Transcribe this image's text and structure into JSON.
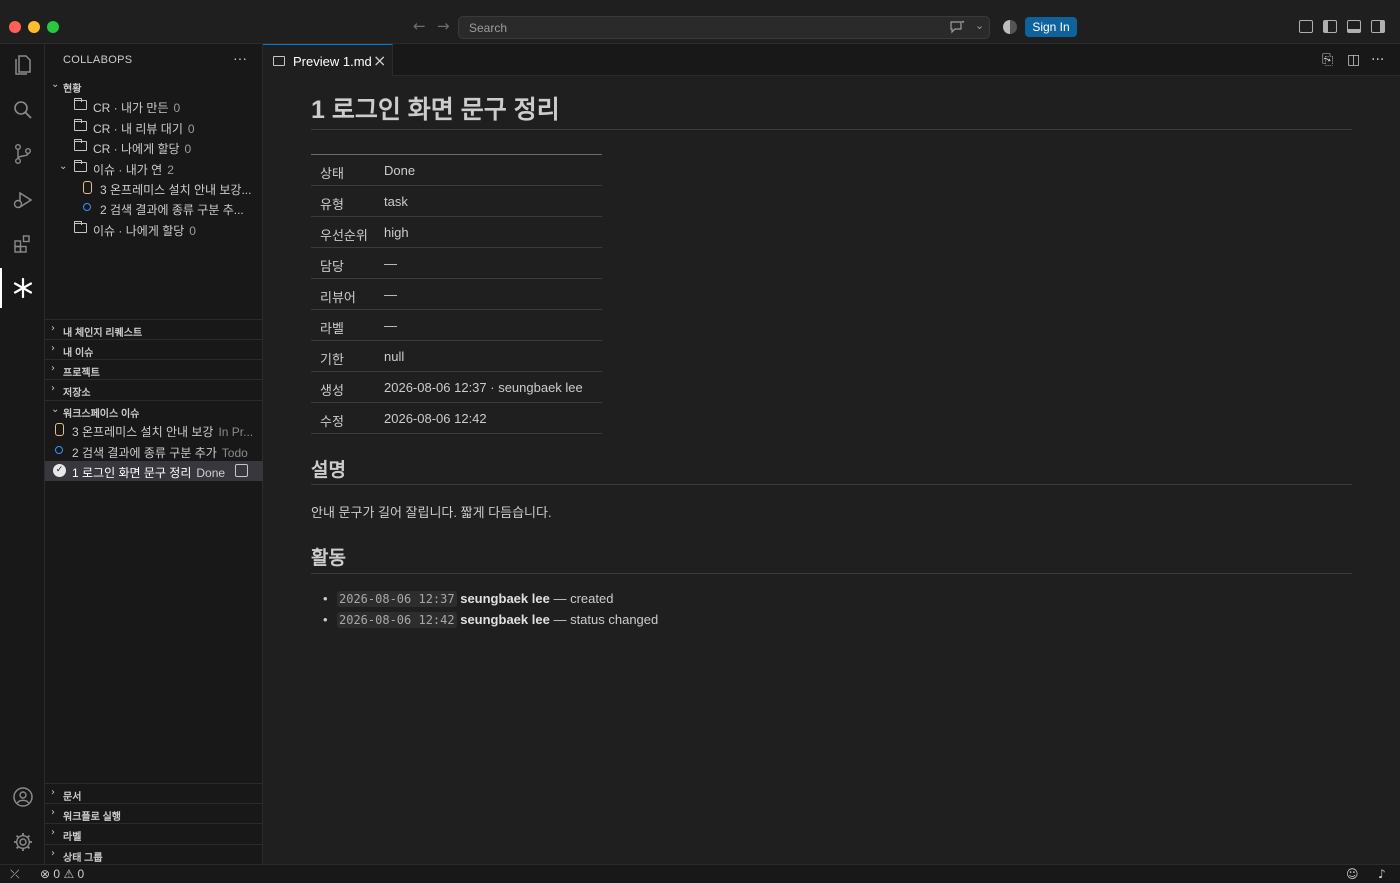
{
  "titlebar": {
    "search_placeholder": "Search",
    "sign_in_label": "Sign In"
  },
  "activity_bar": {
    "items": [
      "files-icon",
      "search-icon",
      "source-control-icon",
      "run-debug-icon",
      "extensions-icon",
      "collabops-icon"
    ],
    "bottom_items": [
      "account-icon",
      "settings-gear-icon"
    ]
  },
  "sidebar": {
    "title": "COLLABOPS",
    "status_section": {
      "label": "현황",
      "items": [
        {
          "label": "CR · 내가 만든",
          "count": "0"
        },
        {
          "label": "CR · 내 리뷰 대기",
          "count": "0"
        },
        {
          "label": "CR · 나에게 할당",
          "count": "0"
        },
        {
          "label": "이슈 · 내가 연",
          "count": "2"
        },
        {
          "label": "3  온프레미스 설치 안내 보강..."
        },
        {
          "label": "2  검색 결과에 종류 구분 추..."
        },
        {
          "label": "이슈 · 나에게 할당",
          "count": "0"
        }
      ]
    },
    "sections": [
      "내 체인지 리퀘스트",
      "내 이슈",
      "프로젝트",
      "저장소"
    ],
    "workspace_issues": {
      "label": "워크스페이스 이슈",
      "items": [
        {
          "label": "3  온프레미스 설치 안내 보강",
          "status": "In Pr..."
        },
        {
          "label": "2  검색 결과에 종류 구분 추가",
          "status": "Todo"
        },
        {
          "label": "1  로그인 화면 문구 정리",
          "status": "Done"
        }
      ]
    },
    "bottom_sections": [
      "문서",
      "워크플로 실행",
      "라벨",
      "상태 그룹"
    ]
  },
  "editor": {
    "tab_label": "Preview 1.md",
    "doc_title": "1 로그인 화면 문구 정리",
    "properties": [
      {
        "key": "상태",
        "value": "Done"
      },
      {
        "key": "유형",
        "value": "task"
      },
      {
        "key": "우선순위",
        "value": "high"
      },
      {
        "key": "담당",
        "value": "—"
      },
      {
        "key": "리뷰어",
        "value": "—"
      },
      {
        "key": "라벨",
        "value": "—"
      },
      {
        "key": "기한",
        "value": "null"
      },
      {
        "key": "생성",
        "value": "2026-08-06 12:37 · seungbaek lee"
      },
      {
        "key": "수정",
        "value": "2026-08-06 12:42"
      }
    ],
    "description_heading": "설명",
    "description": "안내 문구가 길어 잘립니다. 짧게 다듬습니다.",
    "activity_heading": "활동",
    "activity": [
      {
        "time": "2026-08-06 12:37",
        "user": "seungbaek lee",
        "action": "— created"
      },
      {
        "time": "2026-08-06 12:42",
        "user": "seungbaek lee",
        "action": "— status changed"
      }
    ]
  },
  "statusbar": {
    "errors": "0",
    "warnings": "0"
  },
  "colors": {
    "accent": "#0e639c",
    "background": "#1f1f1f",
    "sidebar_bg": "#181818"
  }
}
